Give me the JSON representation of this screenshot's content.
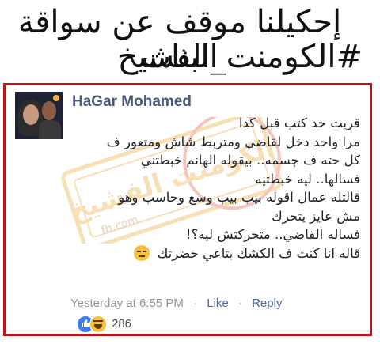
{
  "headline": {
    "line1": "إحكيلنا موقف عن سواقة البنات",
    "line2": "#الكومنت_الفشيخ"
  },
  "watermark": {
    "text": "الكومنت الفشيخ",
    "sub": "fb.com"
  },
  "post": {
    "author": "HaGar Mohamed",
    "lines": [
      "قريت حد كتب قبل كدا",
      "مرا واحد دخل لقاضي ومتربط شاش ومتعور ف",
      "كل حته ف جسمه.. بيقوله الهانم خبطتني",
      "فسالها.. ليه خبطتيه",
      "قالتله عمال اقوله بيب بيب وسع وحاسب وهو",
      "مش عايز يتحرك",
      "فساله القاضي..  متحركتش ليه؟!",
      "قاله انا كنت ف الكشك بتاعي حضرتك"
    ],
    "timestamp": "Yesterday at 6:55 PM",
    "separator": "·",
    "like_label": "Like",
    "reply_label": "Reply",
    "reaction_count": "286"
  },
  "colors": {
    "frame_border": "#c0101a",
    "author_color": "#4b5a7a",
    "link_color": "#4b67a1",
    "meta_color": "#90949c",
    "like_blue": "#3b7cf0",
    "emoji_yellow": "#f5c33b"
  },
  "icons": [
    "like-reaction-icon",
    "haha-reaction-icon",
    "expressionless-emoji-icon"
  ]
}
